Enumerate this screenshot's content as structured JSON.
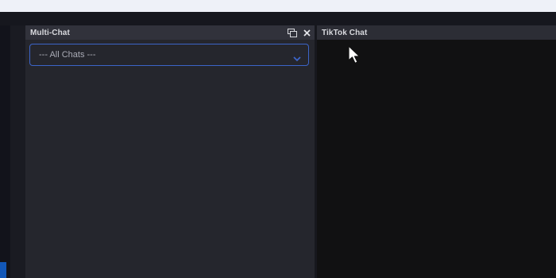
{
  "multichat_panel": {
    "title": "Multi-Chat",
    "icons": {
      "popout": "popout-window-icon",
      "close": "close-icon"
    },
    "chat_select": {
      "value": "--- All Chats ---",
      "chevron": "chevron-down-icon"
    }
  },
  "tiktok_panel": {
    "title": "TikTok Chat"
  },
  "colors": {
    "accent": "#3c64c8",
    "panel_bg": "#25262d",
    "header_bg": "#31323b",
    "chat_bg": "#111112",
    "title_text": "#d8d9de"
  }
}
